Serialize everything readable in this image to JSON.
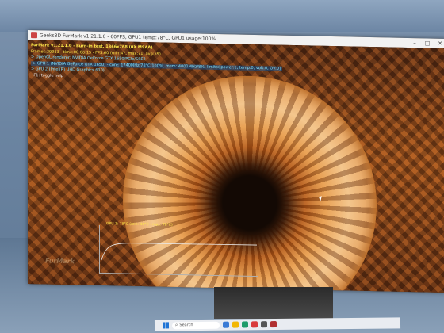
{
  "window": {
    "title": "Geeks3D FurMark v1.21.1.0 - 60FPS, GPU1 temp:78°C, GPU1 usage:100%",
    "controls": [
      "–",
      "□",
      "✕"
    ]
  },
  "hud": {
    "title": "FurMark v1.21.1.0 - Burn-in test, 1366x768 (0X MSAA)",
    "frames": "Frames:29983 - time:00:06:15 - FPS:60 (min:47, max:71, avg:59)",
    "renderer": "> OpenGL renderer: NVIDIA GeForce GTX 1650/PCIe/SSE2",
    "gpu1": "> GPU 1 (NVIDIA GeForce GTX 1650) - core: 1740MHz/78°C/100%, mem: 4001MHz/8%, limits:[power:1, temp:0, volt:0, OV:0]",
    "gpu2": "> GPU 2 (Intel(R) UHD Graphics 630)",
    "help": "- F1: toggle help"
  },
  "graph": {
    "label": "GPU 1: 78°C (min: 46°C - max: 78°C)"
  },
  "taskbar": {
    "search_placeholder": "Search"
  },
  "colors": {
    "hud_title": "#ffe94a",
    "hud_info": "#7ee0ff",
    "taskbar": "#e9ecf1"
  }
}
